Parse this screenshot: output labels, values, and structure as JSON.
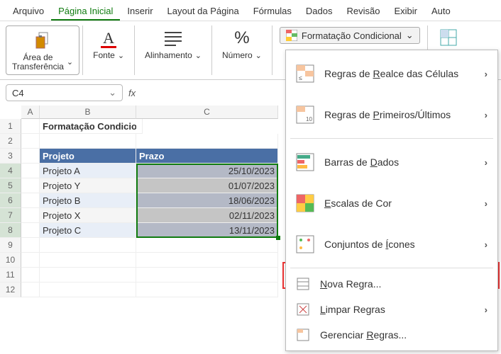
{
  "menu": {
    "file": "Arquivo",
    "home": "Página Inicial",
    "insert": "Inserir",
    "layout": "Layout da Página",
    "formulas": "Fórmulas",
    "data": "Dados",
    "review": "Revisão",
    "view": "Exibir",
    "auto": "Auto"
  },
  "ribbon": {
    "clipboard": "Área de\nTransferência",
    "font": "Fonte",
    "alignment": "Alinhamento",
    "number": "Número",
    "condformat": "Formatação Condicional"
  },
  "namebox": {
    "ref": "C4"
  },
  "columns": [
    "A",
    "B",
    "C"
  ],
  "rows": [
    "1",
    "2",
    "3",
    "4",
    "5",
    "6",
    "7",
    "8",
    "9",
    "10",
    "11",
    "12"
  ],
  "sheet": {
    "title": "Formatação Condicional de Datas Atrasadas",
    "header_proj": "Projeto",
    "header_date": "Prazo",
    "data": [
      {
        "p": "Projeto A",
        "d": "25/10/2023"
      },
      {
        "p": "Projeto Y",
        "d": "01/07/2023"
      },
      {
        "p": "Projeto B",
        "d": "18/06/2023"
      },
      {
        "p": "Projeto X",
        "d": "02/11/2023"
      },
      {
        "p": "Projeto C",
        "d": "13/11/2023"
      }
    ]
  },
  "cfmenu": {
    "highlight": "Regras de Realce das Células",
    "toprules": "Regras de Primeiros/Últimos",
    "databars": "Barras de Dados",
    "colorscales": "Escalas de Cor",
    "iconsets": "Conjuntos de Ícones",
    "newrule": "Nova Regra...",
    "clear": "Limpar Regras",
    "manage": "Gerenciar Regras..."
  }
}
